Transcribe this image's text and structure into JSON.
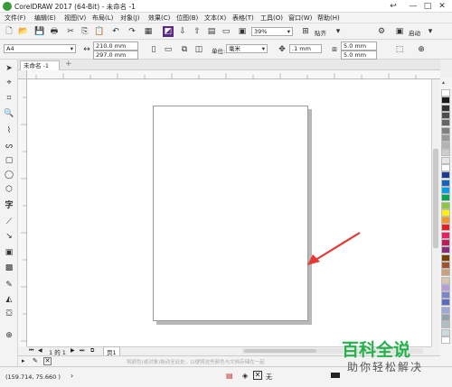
{
  "window": {
    "title": "CorelDRAW 2017 (64-Bit) - 未命名 -1",
    "minimize": "—",
    "restore": "□",
    "close": "✕",
    "back": "↩"
  },
  "menu": [
    "文件(F)",
    "编辑(E)",
    "视图(V)",
    "布局(L)",
    "对象(J)",
    "效果(C)",
    "位图(B)",
    "文本(X)",
    "表格(T)",
    "工具(O)",
    "窗口(W)",
    "帮助(H)"
  ],
  "toolbar": {
    "zoom_value": "39%",
    "snap_label": "贴齐",
    "launch_label": "启动"
  },
  "property_bar": {
    "paper_size": "A4",
    "width_value": "210.0 mm",
    "height_value": "297.0 mm",
    "units_label": "单位:",
    "units_value": "毫米",
    "nudge_value": ".1 mm",
    "dup_x_value": "5.0 mm",
    "dup_y_value": "5.0 mm"
  },
  "document": {
    "tab_label": "未命名 -1",
    "add_tab_icon": "plus-icon"
  },
  "page_nav": {
    "counter": "1 的 1",
    "page_tab": "页1"
  },
  "docpalette_hint": "将颜色(或对象)拖动至此处，以便将这些颜色与文档存储在一起",
  "status": {
    "coordinates": "(159.714, 75.660 )",
    "fill_label": "无"
  },
  "watermark": {
    "line1": "百科全说",
    "line2": "助你轻松解决"
  },
  "palette_colors": [
    "#ffffff",
    "#1a1a1a",
    "#333333",
    "#4d4d4d",
    "#666666",
    "#808080",
    "#999999",
    "#b3b3b3",
    "#cccccc",
    "#e6e6e6",
    "#ffffff",
    "#1f3a93",
    "#1565c0",
    "#00a0e9",
    "#00a651",
    "#8dc63f",
    "#fff200",
    "#f7941d",
    "#ed1c24",
    "#e91e63",
    "#c2185b",
    "#8e2a7e",
    "#7b3f00",
    "#a0522d",
    "#c8a27c",
    "#d9c4b1",
    "#b39ddb",
    "#7986cb",
    "#5c6bc0",
    "#9fa8da",
    "#90a4ae",
    "#b0bec5",
    "#cfd8dc",
    "#ffffff"
  ],
  "colors": {
    "arrow": "#e53935",
    "watermark_green": "#24b24b"
  }
}
